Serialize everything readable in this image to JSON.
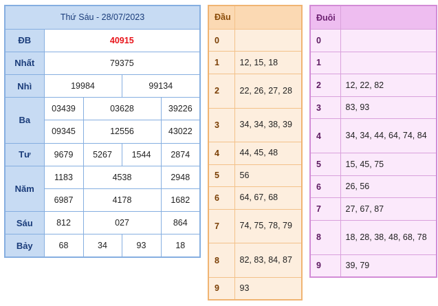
{
  "results": {
    "header": "Thứ Sáu - 28/07/2023",
    "labels": {
      "db": "ĐB",
      "nhat": "Nhất",
      "nhi": "Nhì",
      "ba": "Ba",
      "tu": "Tư",
      "nam": "Năm",
      "sau": "Sáu",
      "bay": "Bảy"
    },
    "db": "40915",
    "nhat": "79375",
    "nhi": [
      "19984",
      "99134"
    ],
    "ba": [
      "03439",
      "03628",
      "39226",
      "09345",
      "12556",
      "43022"
    ],
    "tu": [
      "9679",
      "5267",
      "1544",
      "2874"
    ],
    "nam": [
      "1183",
      "4538",
      "2948",
      "6987",
      "4178",
      "1682"
    ],
    "sau": [
      "812",
      "027",
      "864"
    ],
    "bay": [
      "68",
      "34",
      "93",
      "18"
    ]
  },
  "dau": {
    "header": "Đầu",
    "rows": [
      {
        "key": "0",
        "value": ""
      },
      {
        "key": "1",
        "value": "12, 15, 18"
      },
      {
        "key": "2",
        "value": "22, 26, 27, 28"
      },
      {
        "key": "3",
        "value": "34, 34, 38, 39"
      },
      {
        "key": "4",
        "value": "44, 45, 48"
      },
      {
        "key": "5",
        "value": "56"
      },
      {
        "key": "6",
        "value": "64, 67, 68"
      },
      {
        "key": "7",
        "value": "74, 75, 78, 79"
      },
      {
        "key": "8",
        "value": "82, 83, 84, 87"
      },
      {
        "key": "9",
        "value": "93"
      }
    ]
  },
  "duoi": {
    "header": "Đuôi",
    "rows": [
      {
        "key": "0",
        "value": ""
      },
      {
        "key": "1",
        "value": ""
      },
      {
        "key": "2",
        "value": "12, 22, 82"
      },
      {
        "key": "3",
        "value": "83, 93"
      },
      {
        "key": "4",
        "value": "34, 34, 44, 64, 74, 84"
      },
      {
        "key": "5",
        "value": "15, 45, 75"
      },
      {
        "key": "6",
        "value": "26, 56"
      },
      {
        "key": "7",
        "value": "27, 67, 87"
      },
      {
        "key": "8",
        "value": "18, 28, 38, 48, 68, 78"
      },
      {
        "key": "9",
        "value": "39, 79"
      }
    ]
  },
  "colors": {
    "special_prize": "#e8141a",
    "results_border": "#85aee0",
    "dau_border": "#f0b472",
    "duoi_border": "#d28bd6"
  }
}
